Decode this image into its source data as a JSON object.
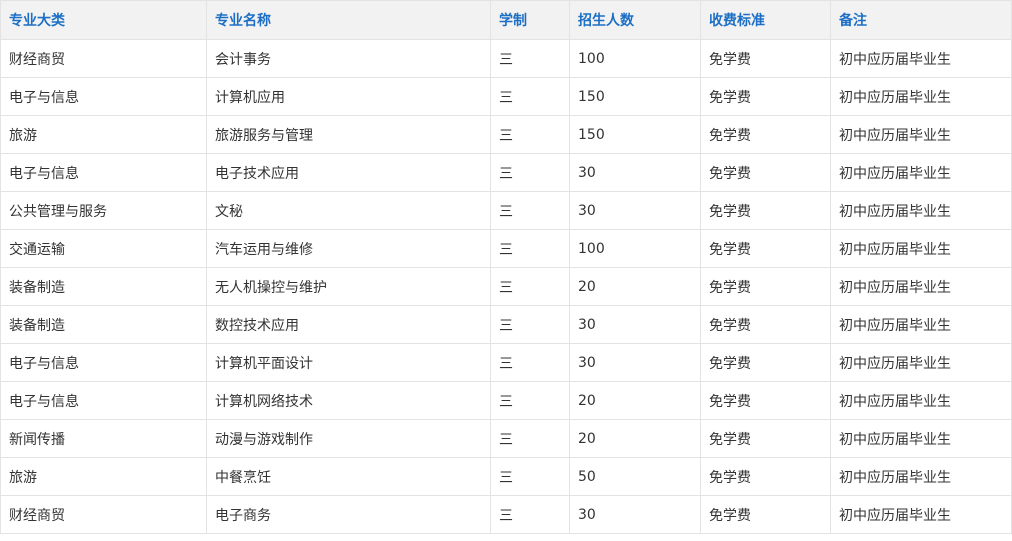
{
  "colors": {
    "header_text": "#1c6fc4",
    "header_bg": "#f2f2f2",
    "cell_text": "#333333",
    "border": "#e3e3e3"
  },
  "table": {
    "headers": [
      "专业大类",
      "专业名称",
      "学制",
      "招生人数",
      "收费标准",
      "备注"
    ],
    "rows": [
      [
        "财经商贸",
        "会计事务",
        "三",
        "100",
        "免学费",
        "初中应历届毕业生"
      ],
      [
        "电子与信息",
        "计算机应用",
        "三",
        "150",
        "免学费",
        "初中应历届毕业生"
      ],
      [
        "旅游",
        "旅游服务与管理",
        "三",
        "150",
        "免学费",
        "初中应历届毕业生"
      ],
      [
        "电子与信息",
        "电子技术应用",
        "三",
        "30",
        "免学费",
        "初中应历届毕业生"
      ],
      [
        "公共管理与服务",
        "文秘",
        "三",
        "30",
        "免学费",
        "初中应历届毕业生"
      ],
      [
        "交通运输",
        "汽车运用与维修",
        "三",
        "100",
        "免学费",
        "初中应历届毕业生"
      ],
      [
        "装备制造",
        "无人机操控与维护",
        "三",
        "20",
        "免学费",
        "初中应历届毕业生"
      ],
      [
        "装备制造",
        "数控技术应用",
        "三",
        "30",
        "免学费",
        "初中应历届毕业生"
      ],
      [
        "电子与信息",
        "计算机平面设计",
        "三",
        "30",
        "免学费",
        "初中应历届毕业生"
      ],
      [
        "电子与信息",
        "计算机网络技术",
        "三",
        "20",
        "免学费",
        "初中应历届毕业生"
      ],
      [
        "新闻传播",
        "动漫与游戏制作",
        "三",
        "20",
        "免学费",
        "初中应历届毕业生"
      ],
      [
        "旅游",
        "中餐烹饪",
        "三",
        "50",
        "免学费",
        "初中应历届毕业生"
      ],
      [
        "财经商贸",
        "电子商务",
        "三",
        "30",
        "免学费",
        "初中应历届毕业生"
      ]
    ]
  }
}
